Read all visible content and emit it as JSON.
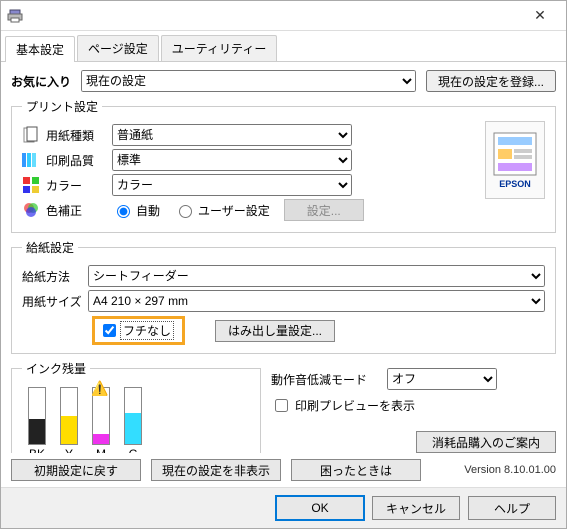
{
  "titlebar": {
    "close": "✕"
  },
  "tabs": {
    "t1": "基本設定",
    "t2": "ページ設定",
    "t3": "ユーティリティー"
  },
  "fav": {
    "label": "お気に入り",
    "current": "現在の設定",
    "register": "現在の設定を登録..."
  },
  "print": {
    "legend": "プリント設定",
    "paper_type_lbl": "用紙種類",
    "paper_type": "普通紙",
    "quality_lbl": "印刷品質",
    "quality": "標準",
    "color_lbl": "カラー",
    "color": "カラー",
    "cc_lbl": "色補正",
    "auto": "自動",
    "user": "ユーザー設定",
    "settings_btn": "設定..."
  },
  "paper": {
    "legend": "給紙設定",
    "source_lbl": "給紙方法",
    "source": "シートフィーダー",
    "size_lbl": "用紙サイズ",
    "size": "A4 210 × 297 mm",
    "borderless": "フチなし",
    "overflow_btn": "はみ出し量設定..."
  },
  "ink": {
    "legend": "インク残量",
    "bk": "BK",
    "y": "Y",
    "m": "M",
    "c": "C"
  },
  "right": {
    "quiet_lbl": "動作音低減モード",
    "quiet": "オフ",
    "preview": "印刷プレビューを表示",
    "supply": "消耗品購入のご案内"
  },
  "footer_a": {
    "reset": "初期設定に戻す",
    "hide": "現在の設定を非表示",
    "help": "困ったときは",
    "version": "Version 8.10.01.00"
  },
  "footer_b": {
    "ok": "OK",
    "cancel": "キャンセル",
    "help": "ヘルプ"
  },
  "brand": "EPSON"
}
